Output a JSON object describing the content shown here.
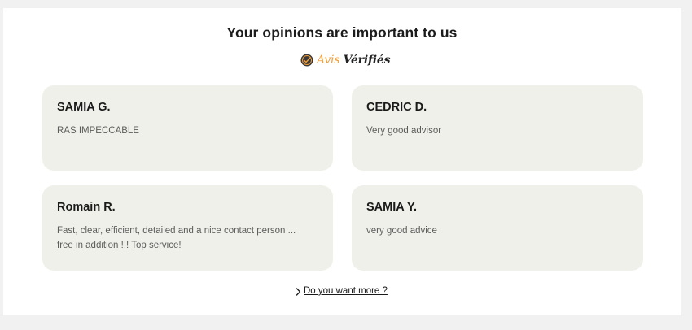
{
  "header": {
    "title": "Your opinions are important to us"
  },
  "brand": {
    "logo_icon": "avis-verifies-logo-icon",
    "name_part1": "Avis",
    "name_part2": "Vérifiés",
    "accent_color": "#f29e38"
  },
  "reviews": [
    {
      "name": "SAMIA G.",
      "text": "RAS IMPECCABLE"
    },
    {
      "name": "CEDRIC D.",
      "text": "Very good advisor"
    },
    {
      "name": "Romain R.",
      "text": "Fast, clear, efficient, detailed and a nice contact person ... free in addition !!! Top service!"
    },
    {
      "name": "SAMIA Y.",
      "text": "very good advice"
    }
  ],
  "more": {
    "icon": "chevron-right-icon",
    "label": "Do you want more ?"
  }
}
